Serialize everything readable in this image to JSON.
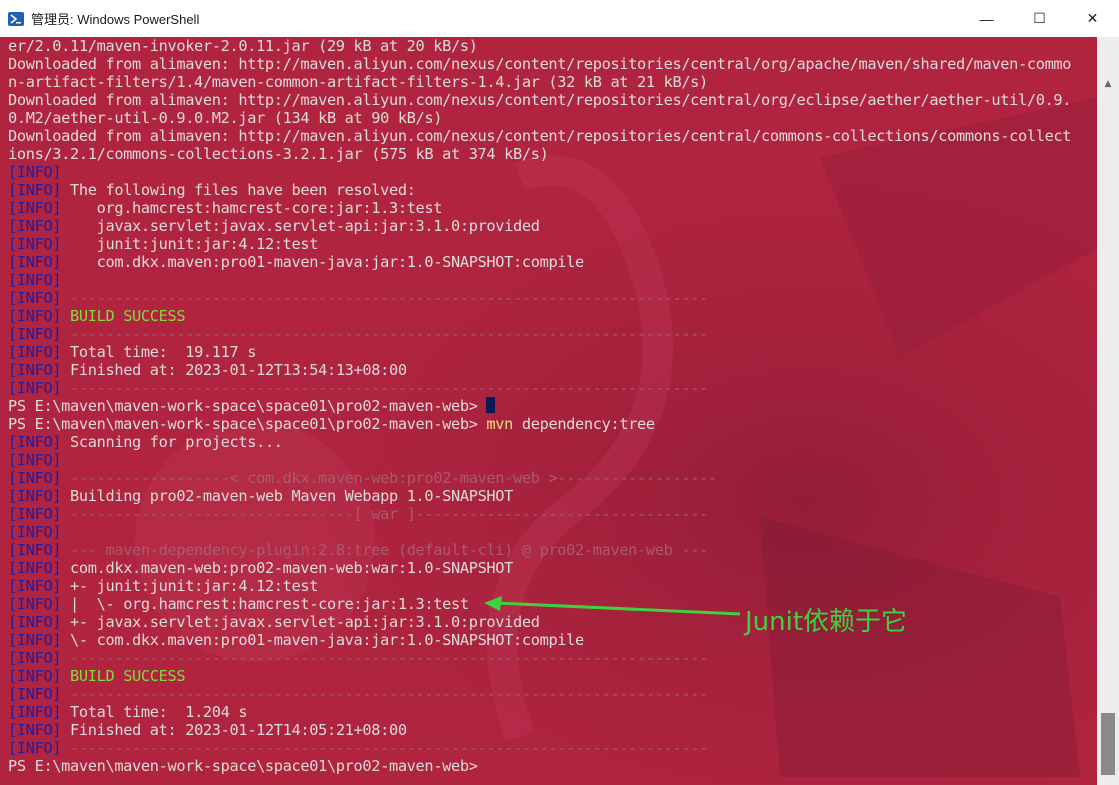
{
  "window": {
    "title": "管理员: Windows PowerShell",
    "controls": {
      "minimize": "—",
      "maximize": "☐",
      "close": "✕"
    }
  },
  "terminal": {
    "lines": [
      {
        "t": "er/2.0.11/maven-invoker-2.0.11.jar (29 kB at 20 kB/s)"
      },
      {
        "t": "Downloaded from alimaven: http://maven.aliyun.com/nexus/content/repositories/central/org/apache/maven/shared/maven-commo"
      },
      {
        "t": "n-artifact-filters/1.4/maven-common-artifact-filters-1.4.jar (32 kB at 21 kB/s)"
      },
      {
        "t": "Downloaded from alimaven: http://maven.aliyun.com/nexus/content/repositories/central/org/eclipse/aether/aether-util/0.9."
      },
      {
        "t": "0.M2/aether-util-0.9.0.M2.jar (134 kB at 90 kB/s)"
      },
      {
        "t": "Downloaded from alimaven: http://maven.aliyun.com/nexus/content/repositories/central/commons-collections/commons-collect"
      },
      {
        "t": "ions/3.2.1/commons-collections-3.2.1.jar (575 kB at 374 kB/s)"
      },
      {
        "info": true,
        "t": ""
      },
      {
        "info": true,
        "t": " The following files have been resolved:"
      },
      {
        "info": true,
        "t": "    org.hamcrest:hamcrest-core:jar:1.3:test"
      },
      {
        "info": true,
        "t": "    javax.servlet:javax.servlet-api:jar:3.1.0:provided"
      },
      {
        "info": true,
        "t": "    junit:junit:jar:4.12:test"
      },
      {
        "info": true,
        "t": "    com.dkx.maven:pro01-maven-java:jar:1.0-SNAPSHOT:compile"
      },
      {
        "info": true,
        "t": ""
      },
      {
        "info": true,
        "t": " ------------------------------------------------------------------------",
        "cls": "dim"
      },
      {
        "info": true,
        "t": " BUILD SUCCESS",
        "cls": "green"
      },
      {
        "info": true,
        "t": " ------------------------------------------------------------------------",
        "cls": "dim"
      },
      {
        "info": true,
        "t": " Total time:  19.117 s"
      },
      {
        "info": true,
        "t": " Finished at: 2023-01-12T13:54:13+08:00"
      },
      {
        "info": true,
        "t": " ------------------------------------------------------------------------",
        "cls": "dim"
      },
      {
        "t": "PS E:\\maven\\maven-work-space\\space01\\pro02-maven-web> ",
        "cursor": true
      },
      {
        "t": "PS E:\\maven\\maven-work-space\\space01\\pro02-maven-web> ",
        "cmd": "mvn",
        "args": " dependency:tree"
      },
      {
        "info": true,
        "t": " Scanning for projects..."
      },
      {
        "info": true,
        "t": ""
      },
      {
        "info": true,
        "t": " ------------------< com.dkx.maven-web:pro02-maven-web >------------------",
        "cls": "dim"
      },
      {
        "info": true,
        "t": " Building pro02-maven-web Maven Webapp 1.0-SNAPSHOT"
      },
      {
        "info": true,
        "t": " --------------------------------[ war ]---------------------------------",
        "cls": "dim"
      },
      {
        "info": true,
        "t": ""
      },
      {
        "info": true,
        "t": " --- maven-dependency-plugin:2.8:tree (default-cli) @ pro02-maven-web ---",
        "cls": "dim"
      },
      {
        "info": true,
        "t": " com.dkx.maven-web:pro02-maven-web:war:1.0-SNAPSHOT"
      },
      {
        "info": true,
        "t": " +- junit:junit:jar:4.12:test"
      },
      {
        "info": true,
        "t": " |  \\- org.hamcrest:hamcrest-core:jar:1.3:test"
      },
      {
        "info": true,
        "t": " +- javax.servlet:javax.servlet-api:jar:3.1.0:provided"
      },
      {
        "info": true,
        "t": " \\- com.dkx.maven:pro01-maven-java:jar:1.0-SNAPSHOT:compile"
      },
      {
        "info": true,
        "t": " ------------------------------------------------------------------------",
        "cls": "dim"
      },
      {
        "info": true,
        "t": " BUILD SUCCESS",
        "cls": "green"
      },
      {
        "info": true,
        "t": " ------------------------------------------------------------------------",
        "cls": "dim"
      },
      {
        "info": true,
        "t": " Total time:  1.204 s"
      },
      {
        "info": true,
        "t": " Finished at: 2023-01-12T14:05:21+08:00"
      },
      {
        "info": true,
        "t": " ------------------------------------------------------------------------",
        "cls": "dim"
      },
      {
        "t": "PS E:\\maven\\maven-work-space\\space01\\pro02-maven-web>"
      }
    ],
    "info_tag": "[INFO]"
  },
  "annotation": {
    "text": "Junit依赖于它",
    "color": "#3ed23e"
  },
  "colors": {
    "background": "#b0243f",
    "info": "#1d1da6",
    "success": "#7fdc3a",
    "command": "#f0e07a"
  }
}
